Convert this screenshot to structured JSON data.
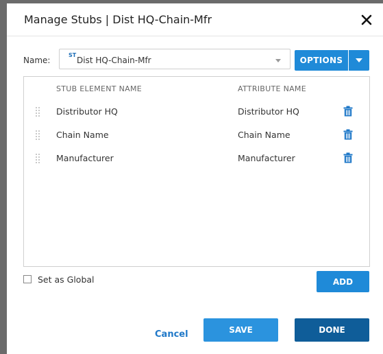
{
  "dialog": {
    "title": "Manage Stubs | Dist HQ-Chain-Mfr",
    "close_icon": "close-icon"
  },
  "name_field": {
    "label": "Name:",
    "prefix": "ST",
    "value": "Dist HQ-Chain-Mfr"
  },
  "options_button": {
    "label": "OPTIONS",
    "caret_icon": "chevron-down-icon"
  },
  "table": {
    "columns": [
      "STUB ELEMENT NAME",
      "ATTRIBUTE NAME"
    ],
    "rows": [
      {
        "stub": "Distributor HQ",
        "attribute": "Distributor HQ"
      },
      {
        "stub": "Chain Name",
        "attribute": "Chain Name"
      },
      {
        "stub": "Manufacturer",
        "attribute": "Manufacturer"
      }
    ],
    "row_icons": [
      "drag-handle-icon",
      "trash-icon"
    ]
  },
  "global_checkbox": {
    "label": "Set as Global",
    "checked": false
  },
  "buttons": {
    "add": "ADD",
    "cancel": "Cancel",
    "save": "SAVE",
    "done": "DONE"
  },
  "colors": {
    "primary": "#1f8ad8",
    "primary_dark": "#0f5d99",
    "link": "#1f78c8",
    "overlay": "#6b6b6b"
  }
}
